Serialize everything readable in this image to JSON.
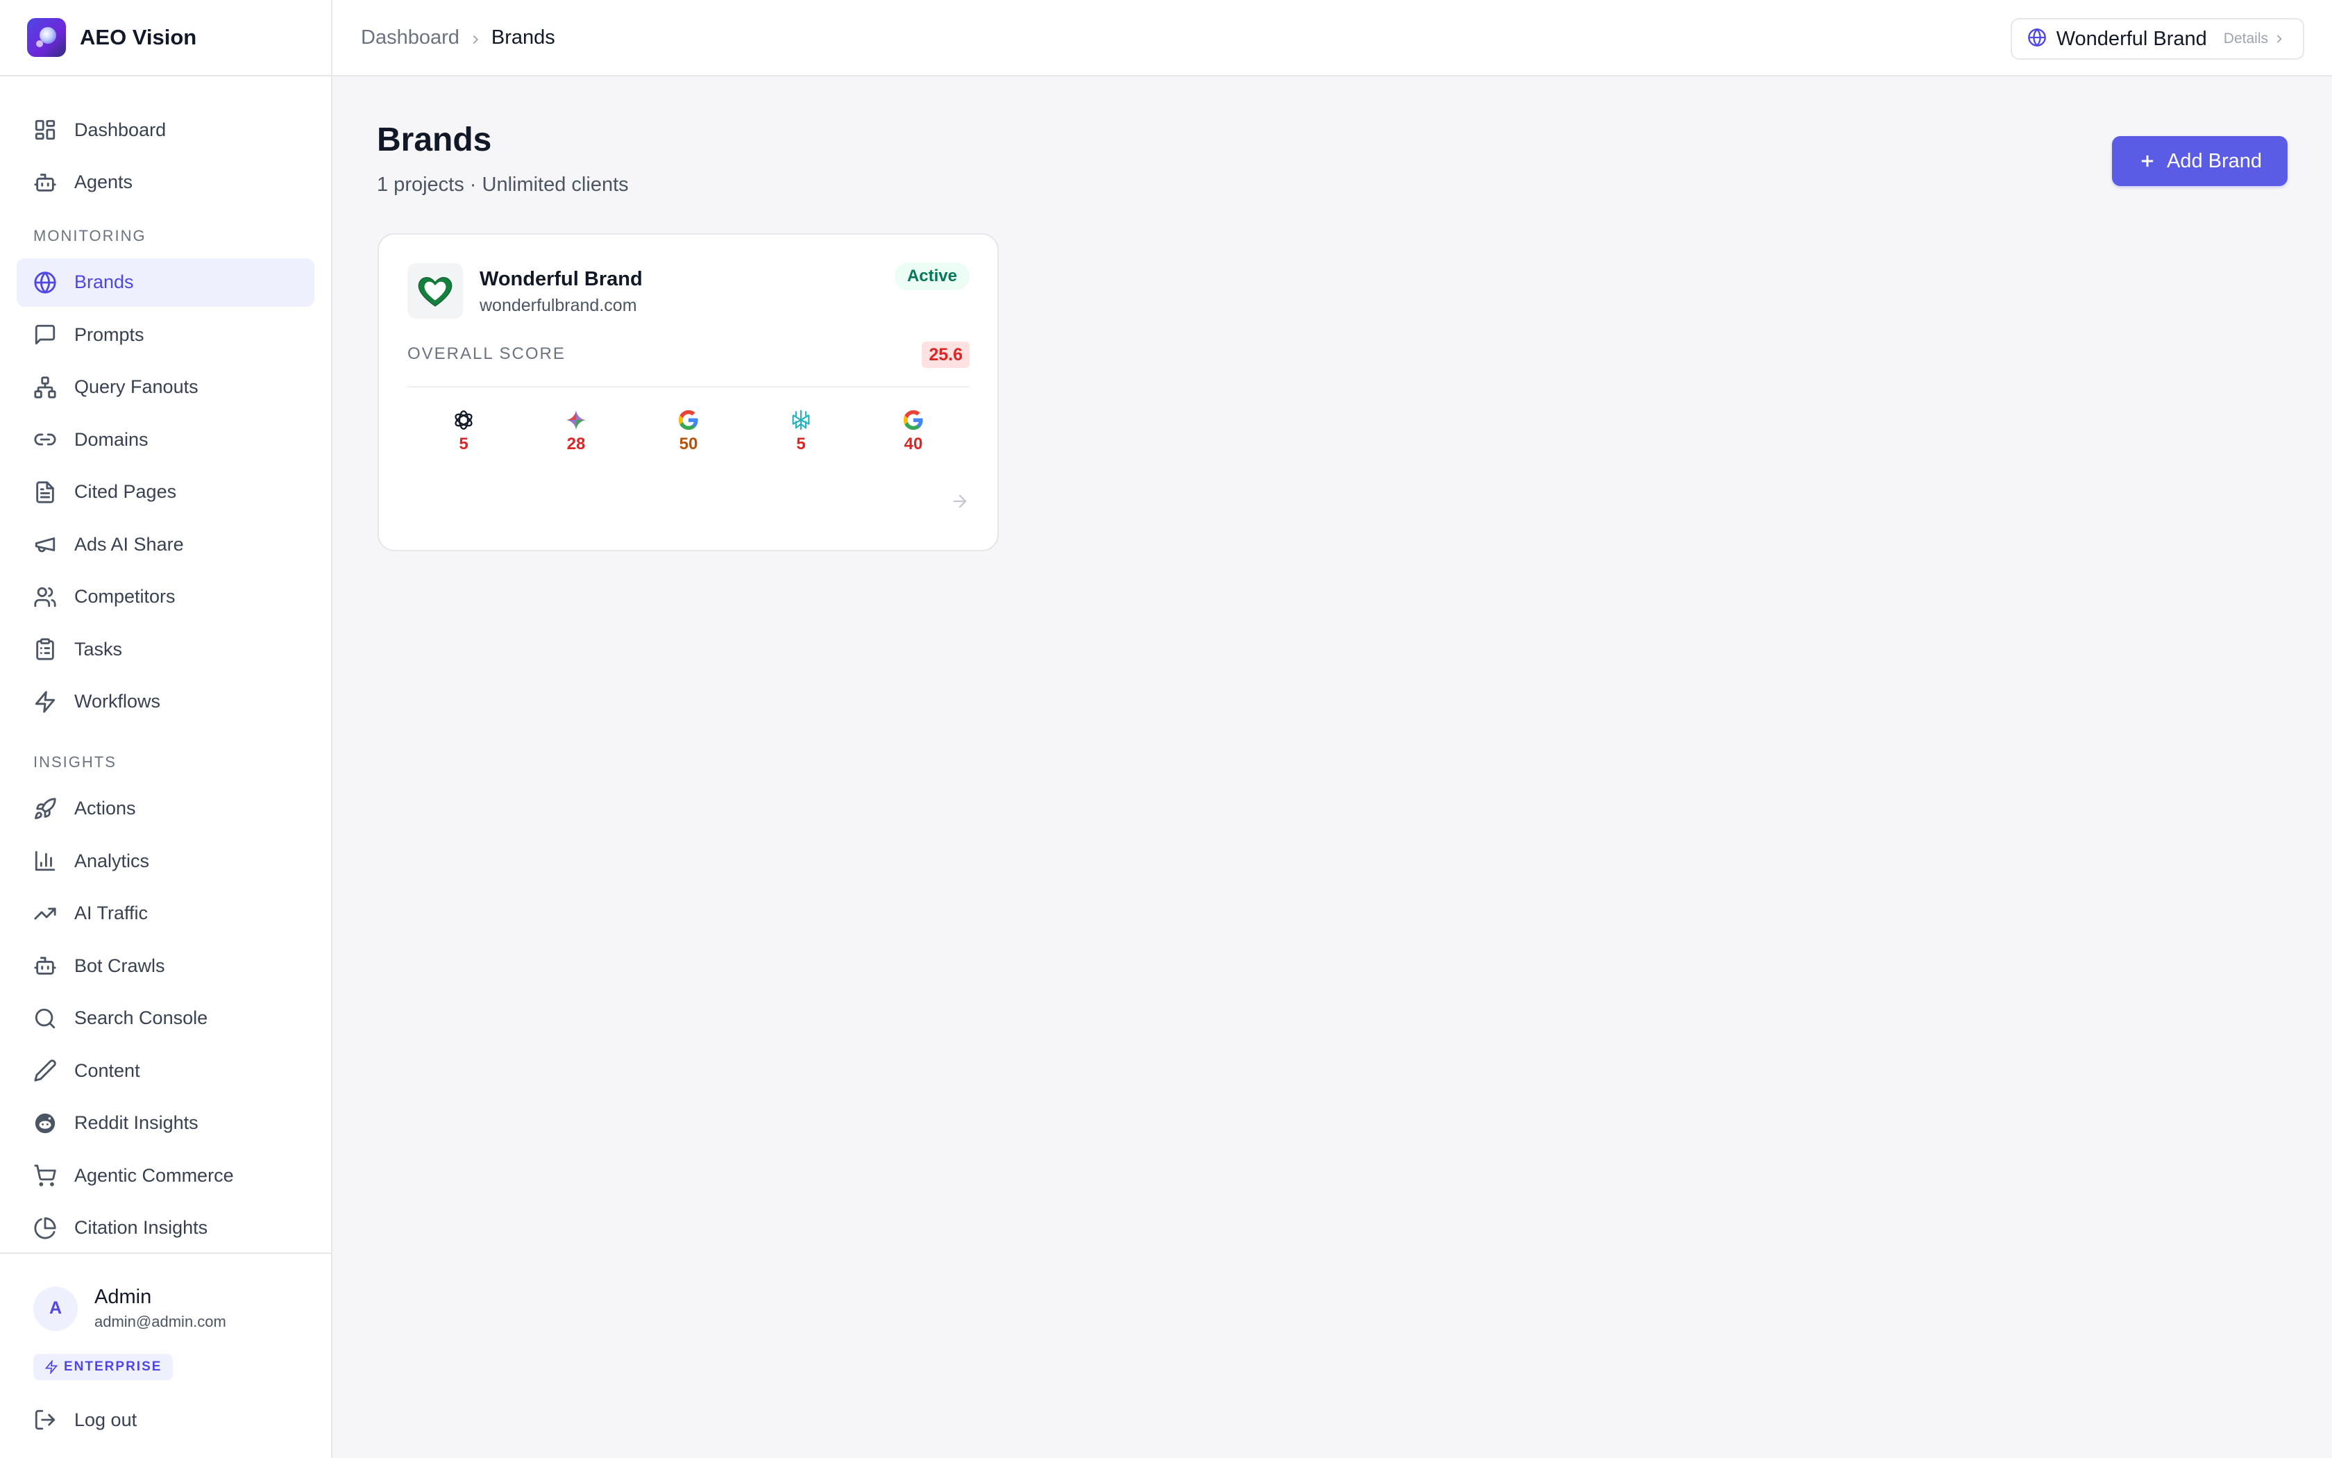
{
  "app": {
    "name": "AEO Vision"
  },
  "nav": {
    "top": [
      {
        "label": "Dashboard",
        "icon": "layout-dashboard-icon"
      },
      {
        "label": "Agents",
        "icon": "bot-icon"
      }
    ],
    "monitoring_label": "MONITORING",
    "monitoring": [
      {
        "label": "Brands",
        "icon": "globe-icon",
        "active": true
      },
      {
        "label": "Prompts",
        "icon": "message-square-icon"
      },
      {
        "label": "Query Fanouts",
        "icon": "network-icon"
      },
      {
        "label": "Domains",
        "icon": "link-icon"
      },
      {
        "label": "Cited Pages",
        "icon": "file-text-icon"
      },
      {
        "label": "Ads AI Share",
        "icon": "megaphone-icon"
      },
      {
        "label": "Competitors",
        "icon": "users-icon"
      },
      {
        "label": "Tasks",
        "icon": "clipboard-list-icon"
      },
      {
        "label": "Workflows",
        "icon": "zap-icon"
      }
    ],
    "insights_label": "INSIGHTS",
    "insights": [
      {
        "label": "Actions",
        "icon": "rocket-icon"
      },
      {
        "label": "Analytics",
        "icon": "bar-chart-icon"
      },
      {
        "label": "AI Traffic",
        "icon": "trending-up-icon"
      },
      {
        "label": "Bot Crawls",
        "icon": "bot-icon"
      },
      {
        "label": "Search Console",
        "icon": "search-icon"
      },
      {
        "label": "Content",
        "icon": "pencil-icon"
      },
      {
        "label": "Reddit Insights",
        "icon": "reddit-icon"
      },
      {
        "label": "Agentic Commerce",
        "icon": "shopping-cart-icon"
      },
      {
        "label": "Citation Insights",
        "icon": "pie-chart-icon"
      }
    ]
  },
  "user": {
    "initial": "A",
    "name": "Admin",
    "email": "admin@admin.com",
    "plan": "ENTERPRISE",
    "logout_label": "Log out"
  },
  "topbar": {
    "breadcrumb": [
      "Dashboard",
      "Brands"
    ],
    "brand_switch": {
      "name": "Wonderful Brand",
      "details_label": "Details"
    }
  },
  "page": {
    "title": "Brands",
    "subtitle": "1 projects · Unlimited clients",
    "add_button": "Add Brand"
  },
  "brand_card": {
    "name": "Wonderful Brand",
    "domain": "wonderfulbrand.com",
    "status": "Active",
    "score_label": "OVERALL SCORE",
    "score": "25.6",
    "engines": [
      {
        "icon": "openai-icon",
        "score": "5",
        "color": "#dc2626"
      },
      {
        "icon": "gemini-icon",
        "score": "28",
        "color": "#dc2626"
      },
      {
        "icon": "google-icon",
        "score": "50",
        "color": "#b45309"
      },
      {
        "icon": "perplexity-icon",
        "score": "5",
        "color": "#dc2626"
      },
      {
        "icon": "google-ai-overview-icon",
        "score": "40",
        "color": "#dc2626"
      }
    ]
  },
  "colors": {
    "accent": "#4f46e5",
    "button": "#5b5ce6",
    "active_green": "#047857",
    "score_red": "#dc2626",
    "score_amber": "#b45309"
  }
}
